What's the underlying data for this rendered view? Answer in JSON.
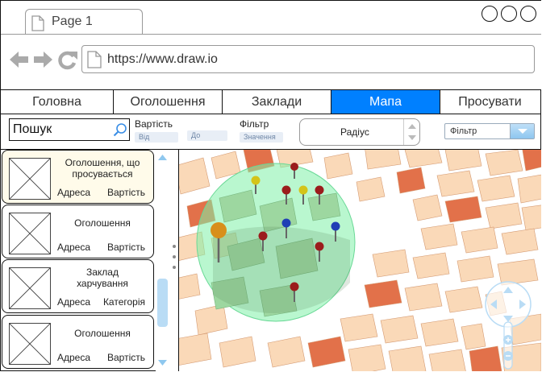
{
  "browser": {
    "tab_label": "Page 1",
    "url": "https://www.draw.io"
  },
  "nav_tabs": [
    {
      "label": "Головна",
      "active": false
    },
    {
      "label": "Оголошення",
      "active": false
    },
    {
      "label": "Заклади",
      "active": false
    },
    {
      "label": "Мапа",
      "active": true
    },
    {
      "label": "Просувати",
      "active": false
    }
  ],
  "filters": {
    "search_value": "Пошук",
    "price_label": "Вартість",
    "price_from_placeholder": "Від",
    "price_to_placeholder": "До",
    "filter_label": "Фільтр",
    "filter_value_placeholder": "Значення",
    "radius_label": "Радіус",
    "filter_select_value": "Фільтр"
  },
  "listings": [
    {
      "title": "Оголошення, що просувається",
      "left": "Адреса",
      "right": "Вартість",
      "highlight": true
    },
    {
      "title": "Оголошення",
      "left": "Адреса",
      "right": "Вартість",
      "highlight": false
    },
    {
      "title": "Заклад харчування",
      "left": "Адреса",
      "right": "Категорія",
      "highlight": false
    },
    {
      "title": "Оголошення",
      "left": "Адреса",
      "right": "Вартість",
      "highlight": false
    }
  ],
  "map": {
    "pins": [
      "red",
      "red",
      "yellow",
      "red",
      "yellow",
      "red",
      "blue",
      "blue",
      "red",
      "red",
      "red",
      "orange"
    ],
    "radius_fill": "#7ff0a8",
    "accent": "#0080ff"
  }
}
